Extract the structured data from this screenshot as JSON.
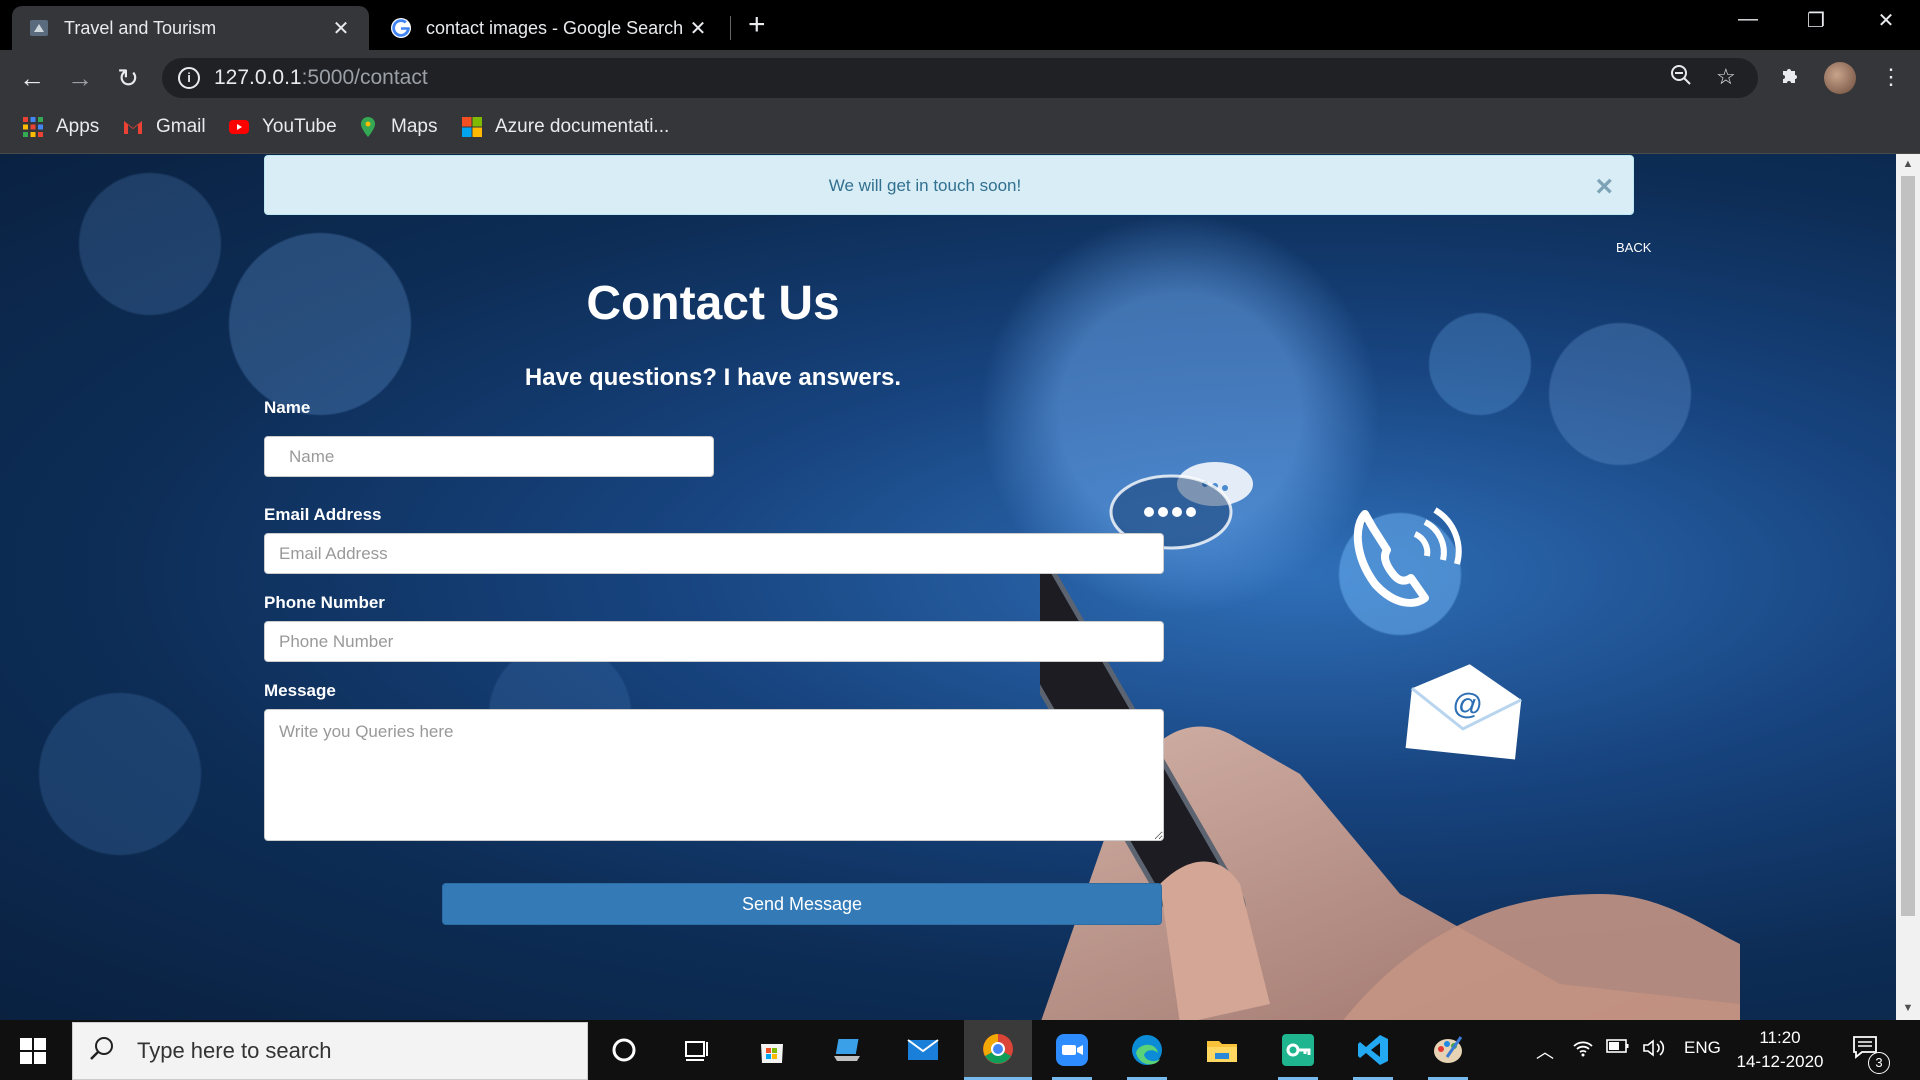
{
  "browser": {
    "tabs": [
      {
        "title": "Travel and Tourism",
        "active": true
      },
      {
        "title": "contact images - Google Search",
        "active": false
      }
    ],
    "url_host": "127.0.0.1",
    "url_path": ":5000/contact",
    "bookmarks": [
      {
        "label": "Apps",
        "icon": "apps-grid-icon"
      },
      {
        "label": "Gmail",
        "icon": "gmail-icon"
      },
      {
        "label": "YouTube",
        "icon": "youtube-icon"
      },
      {
        "label": "Maps",
        "icon": "maps-pin-icon"
      },
      {
        "label": "Azure documentati...",
        "icon": "microsoft-icon"
      }
    ]
  },
  "alert": {
    "message": "We will get in touch soon!",
    "close_label": "×",
    "color_bg": "#d9edf7",
    "color_text": "#31708f"
  },
  "page": {
    "back_label": "BACK",
    "title": "Contact Us",
    "subtitle": "Have questions? I have answers.",
    "send_label": "Send Message",
    "accent": "#337ab7"
  },
  "form": {
    "name": {
      "label": "Name",
      "placeholder": "Name"
    },
    "email": {
      "label": "Email Address",
      "placeholder": "Email Address"
    },
    "phone": {
      "label": "Phone Number",
      "placeholder": "Phone Number"
    },
    "message": {
      "label": "Message",
      "placeholder": "Write you Queries here"
    }
  },
  "taskbar": {
    "search_placeholder": "Type here to search",
    "language": "ENG",
    "time": "11:20",
    "date": "14-12-2020",
    "notification_count": "3"
  }
}
